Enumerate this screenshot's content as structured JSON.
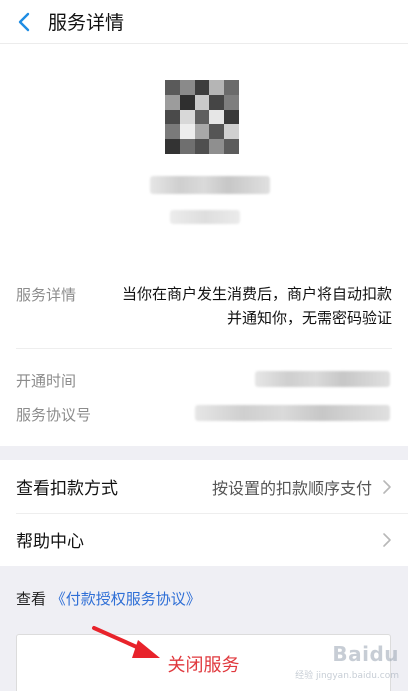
{
  "header": {
    "title": "服务详情"
  },
  "merchant": {
    "logo_blurred": true,
    "name_blurred": true
  },
  "info": {
    "detail_label": "服务详情",
    "detail_value": "当你在商户发生消费后，商户将自动扣款并通知你，无需密码验证",
    "open_time_label": "开通时间",
    "agreement_no_label": "服务协议号"
  },
  "menu": {
    "payment_method_label": "查看扣款方式",
    "payment_method_value": "按设置的扣款顺序支付",
    "help_center_label": "帮助中心"
  },
  "agreement": {
    "prefix": "查看",
    "link_text": "《付款授权服务协议》"
  },
  "actions": {
    "close_service_label": "关闭服务"
  },
  "watermark": {
    "brand": "Baidu",
    "sub": "经验 jingyan.baidu.com"
  },
  "colors": {
    "accent_blue": "#2f6fd6",
    "danger_red": "#e0393e",
    "annotation_red": "#e8232b",
    "back_arrow": "#1e8ce3"
  }
}
